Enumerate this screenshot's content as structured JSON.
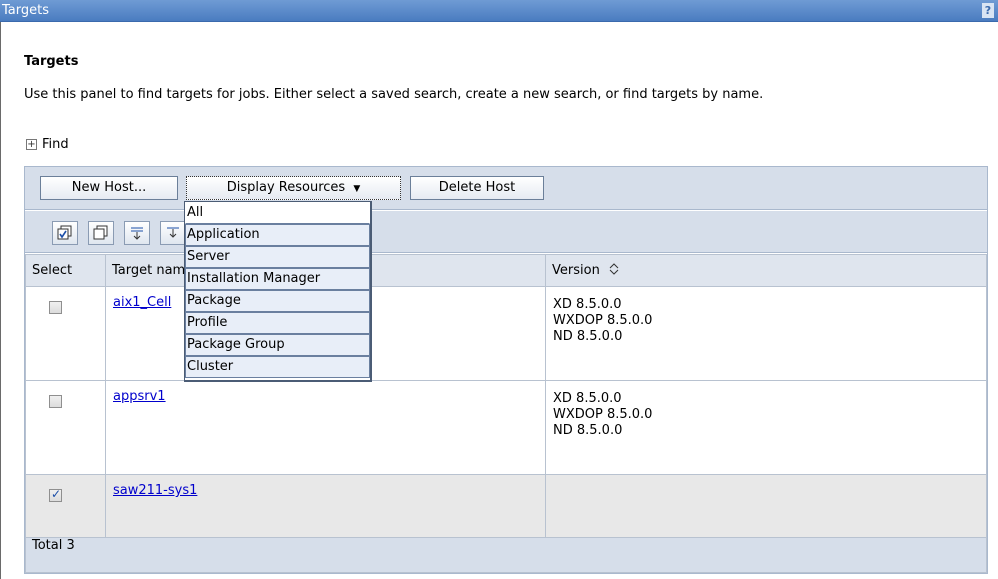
{
  "window": {
    "title": "Targets",
    "help_glyph": "?"
  },
  "page": {
    "heading": "Targets",
    "description": "Use this panel to find targets for jobs. Either select a saved search, create a new search, or find targets by name.",
    "find_toggle_glyph": "+",
    "find_label": "Find"
  },
  "toolbar": {
    "new_host": "New Host...",
    "display_resources": "Display Resources",
    "display_resources_arrow": "▼",
    "delete_host": "Delete Host"
  },
  "icon_toolbar": [
    "select-all-icon",
    "deselect-all-icon",
    "expand-icon",
    "collapse-icon"
  ],
  "dropdown": {
    "items": [
      "All",
      "Application",
      "Server",
      "Installation Manager",
      "Package",
      "Profile",
      "Package Group",
      "Cluster"
    ]
  },
  "table": {
    "headers": {
      "select": "Select",
      "target_name": "Target name",
      "version": "Version"
    },
    "sort_icon": "sort-arrows-icon",
    "rows": [
      {
        "name": "aix1_Cell",
        "checked": false,
        "versions": [
          "XD 8.5.0.0",
          "WXDOP 8.5.0.0",
          "ND 8.5.0.0"
        ]
      },
      {
        "name": "appsrv1",
        "checked": false,
        "versions": [
          "XD 8.5.0.0",
          "WXDOP 8.5.0.0",
          "ND 8.5.0.0"
        ]
      },
      {
        "name": "saw211-sys1",
        "checked": true,
        "versions": []
      }
    ],
    "total": "Total 3"
  },
  "colors": {
    "titlebar": "#4a7cc0",
    "toolbar_bg": "#d6deea",
    "link": "#0000cc"
  }
}
